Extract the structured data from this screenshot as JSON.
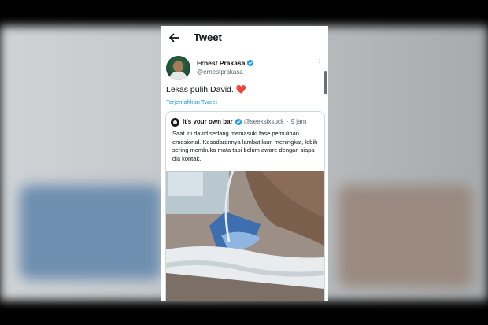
{
  "header": {
    "title": "Tweet"
  },
  "author": {
    "name": "Ernest Prakasa",
    "handle": "@ernestprakasa"
  },
  "tweet": {
    "text": "Lekas pulih David.",
    "emoji": "❤️",
    "translate": "Terjemahkan Tweet"
  },
  "quoted": {
    "name": "It's your own bar",
    "handle": "@seeksixsuck",
    "separator": "·",
    "time": "9 jam",
    "text": "Saat ini david sedang memasuki fase pemulihan emosional. Kesadarannya lambat laun meningkat, lebih sering membuka mata tapi belum aware dengan siapa dia kontak."
  },
  "colors": {
    "accent": "#1d9bf0",
    "heart": "#e0245e",
    "text": "#0f1419",
    "muted": "#536471"
  },
  "icons": [
    "back-arrow-icon",
    "verified-badge-icon",
    "more-options-icon"
  ]
}
